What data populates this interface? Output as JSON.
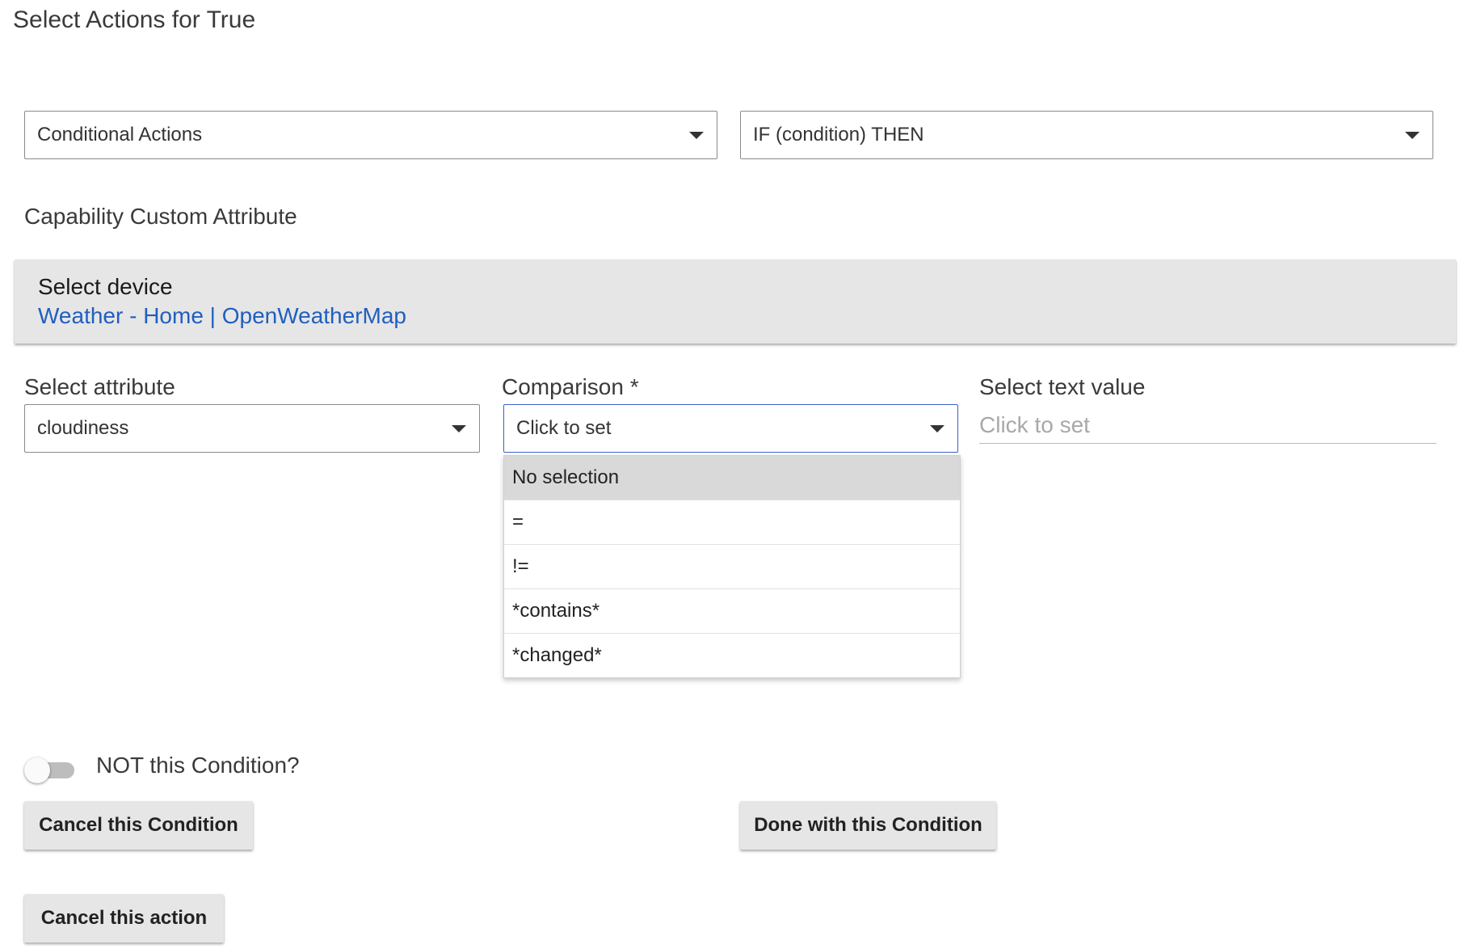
{
  "page": {
    "title": "Select Actions for True"
  },
  "action_type": {
    "selected": "Conditional Actions"
  },
  "action": {
    "selected": "IF (condition) THEN"
  },
  "capability": {
    "label": "Capability Custom Attribute"
  },
  "device": {
    "label": "Select device",
    "value": "Weather - Home | OpenWeatherMap"
  },
  "attribute": {
    "label": "Select attribute",
    "selected": "cloudiness"
  },
  "comparison": {
    "label": "Comparison *",
    "selected": "Click to set",
    "options": [
      "No selection",
      "=",
      "!=",
      "*contains*",
      "*changed*"
    ],
    "highlighted_index": 0
  },
  "text_value": {
    "label": "Select text value",
    "placeholder": "Click to set"
  },
  "not_condition": {
    "label": "NOT this Condition?",
    "on": false
  },
  "buttons": {
    "cancel_condition": "Cancel this Condition",
    "done_condition": "Done with this Condition",
    "cancel_action": "Cancel this action"
  },
  "colors": {
    "link": "#1f5fbf",
    "focus_border": "#3a63c8",
    "panel_bg": "#e6e6e6"
  }
}
